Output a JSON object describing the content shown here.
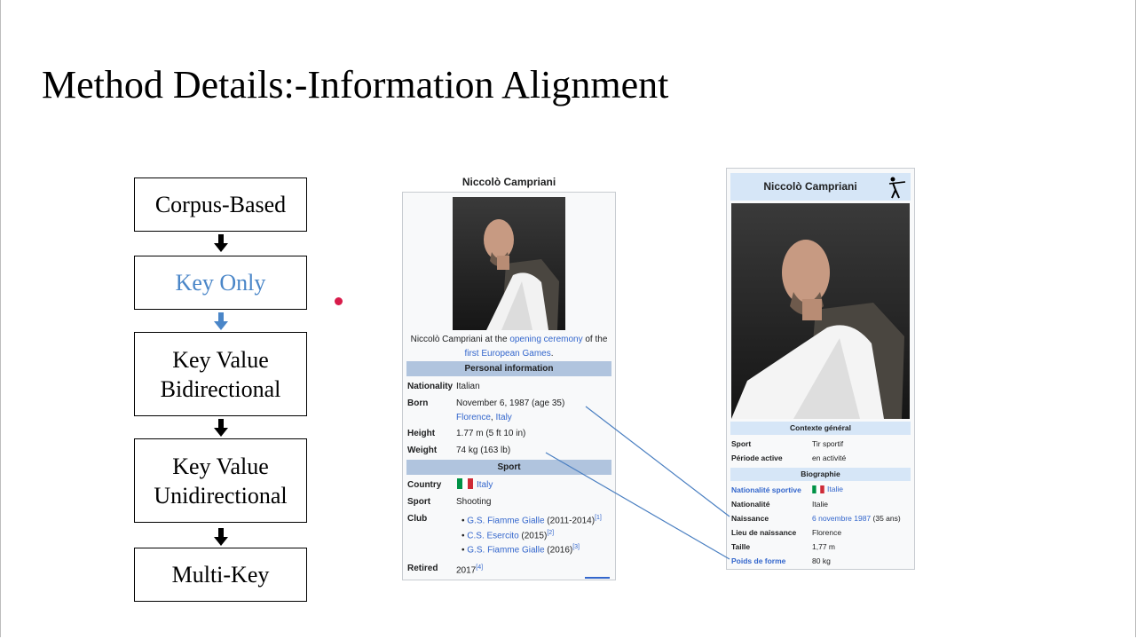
{
  "slide": {
    "title": "Method Details:-Information Alignment"
  },
  "flow": {
    "steps": [
      {
        "label": "Corpus-Based",
        "highlight": false
      },
      {
        "label": "Key Only",
        "highlight": true
      },
      {
        "label": "Key Value Bidirectional",
        "highlight": false
      },
      {
        "label": "Key Value Unidirectional",
        "highlight": false
      },
      {
        "label": "Multi-Key",
        "highlight": false
      }
    ],
    "colors": {
      "highlight_text": "#4a86c8",
      "highlight_arrow": "#4a86c8",
      "arrow": "#000000"
    }
  },
  "en_infobox": {
    "name": "Niccolò Campriani",
    "caption_prefix": "Niccolò Campriani at the ",
    "caption_link1": "opening ceremony",
    "caption_mid": " of the",
    "caption_link2": "first European Games",
    "caption_end": ".",
    "personal_header": "Personal information",
    "nationality_label": "Nationality",
    "nationality_value": "Italian",
    "born_label": "Born",
    "born_value": "November 6, 1987 (age 35)",
    "born_place_1": "Florence",
    "born_place_sep": ", ",
    "born_place_2": "Italy",
    "height_label": "Height",
    "height_value": "1.77 m (5 ft 10 in)",
    "weight_label": "Weight",
    "weight_value": "74 kg (163 lb)",
    "sport_header": "Sport",
    "country_label": "Country",
    "country_value": "Italy",
    "sport_label": "Sport",
    "sport_value": "Shooting",
    "club_label": "Club",
    "clubs": [
      {
        "name": "G.S. Fiamme Gialle",
        "years": " (2011-2014)",
        "ref": "[1]"
      },
      {
        "name": "C.S. Esercito",
        "years": " (2015)",
        "ref": "[2]"
      },
      {
        "name": "G.S. Fiamme Gialle",
        "years": " (2016)",
        "ref": "[3]"
      }
    ],
    "retired_label": "Retired",
    "retired_value": "2017",
    "retired_ref": "[4]"
  },
  "fr_infobox": {
    "name": "Niccolò Campriani",
    "icon": "shooter-icon",
    "context_header": "Contexte général",
    "sport_label": "Sport",
    "sport_value": "Tir sportif",
    "period_label": "Période active",
    "period_value": "en activité",
    "bio_header": "Biographie",
    "nat_sport_label": "Nationalité sportive",
    "nat_sport_value": "Italie",
    "nationality_label": "Nationalité",
    "nationality_value": "Italie",
    "birth_label": "Naissance",
    "birth_value": "6 novembre 1987",
    "birth_age": " (35 ans)",
    "birthplace_label": "Lieu de naissance",
    "birthplace_value": "Florence",
    "height_label": "Taille",
    "height_value": "1,77 m",
    "weight_label": "Poids de forme",
    "weight_value": "80 kg"
  },
  "colors": {
    "link": "#3366cc",
    "header_en": "#b0c4de",
    "header_fr": "#d6e6f7",
    "dot": "#d81b4a"
  }
}
